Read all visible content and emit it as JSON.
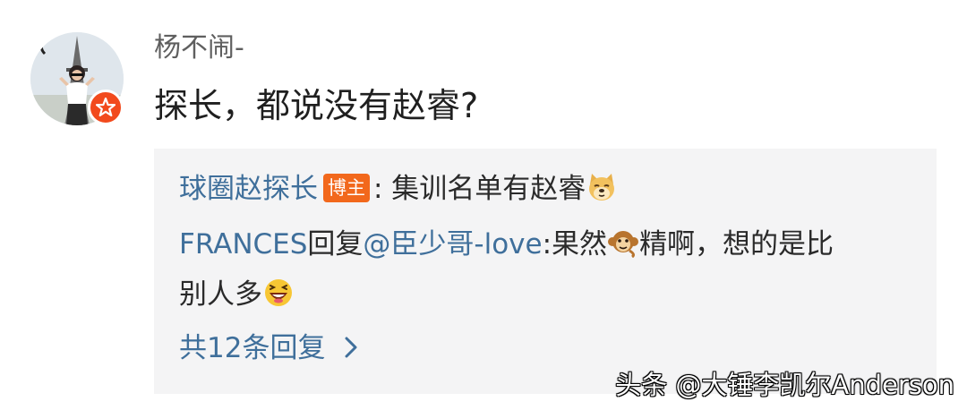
{
  "comment": {
    "username": "杨不闹-",
    "text": "探长，都说没有赵睿?"
  },
  "replies": {
    "reply1": {
      "author": "球圈赵探长",
      "badge": "博主",
      "text": ": 集训名单有赵睿",
      "emoji": "doge-emoji"
    },
    "reply2": {
      "author": "FRANCES",
      "middle": "回复",
      "mention": "@臣少哥-love",
      "text_before_emoji": ":果然",
      "emoji": "monkey-emoji",
      "text_after_emoji": "精啊，想的是比",
      "text_line2": "别人多",
      "emoji2": "laughing-emoji"
    },
    "more_replies": "共12条回复"
  },
  "watermark": "头条 @大锤李凯尔Anderson",
  "colors": {
    "link": "#3f6f9b",
    "badge": "#f2681c",
    "verified": "#f24a1d",
    "reply_bg": "#f4f4f5"
  }
}
